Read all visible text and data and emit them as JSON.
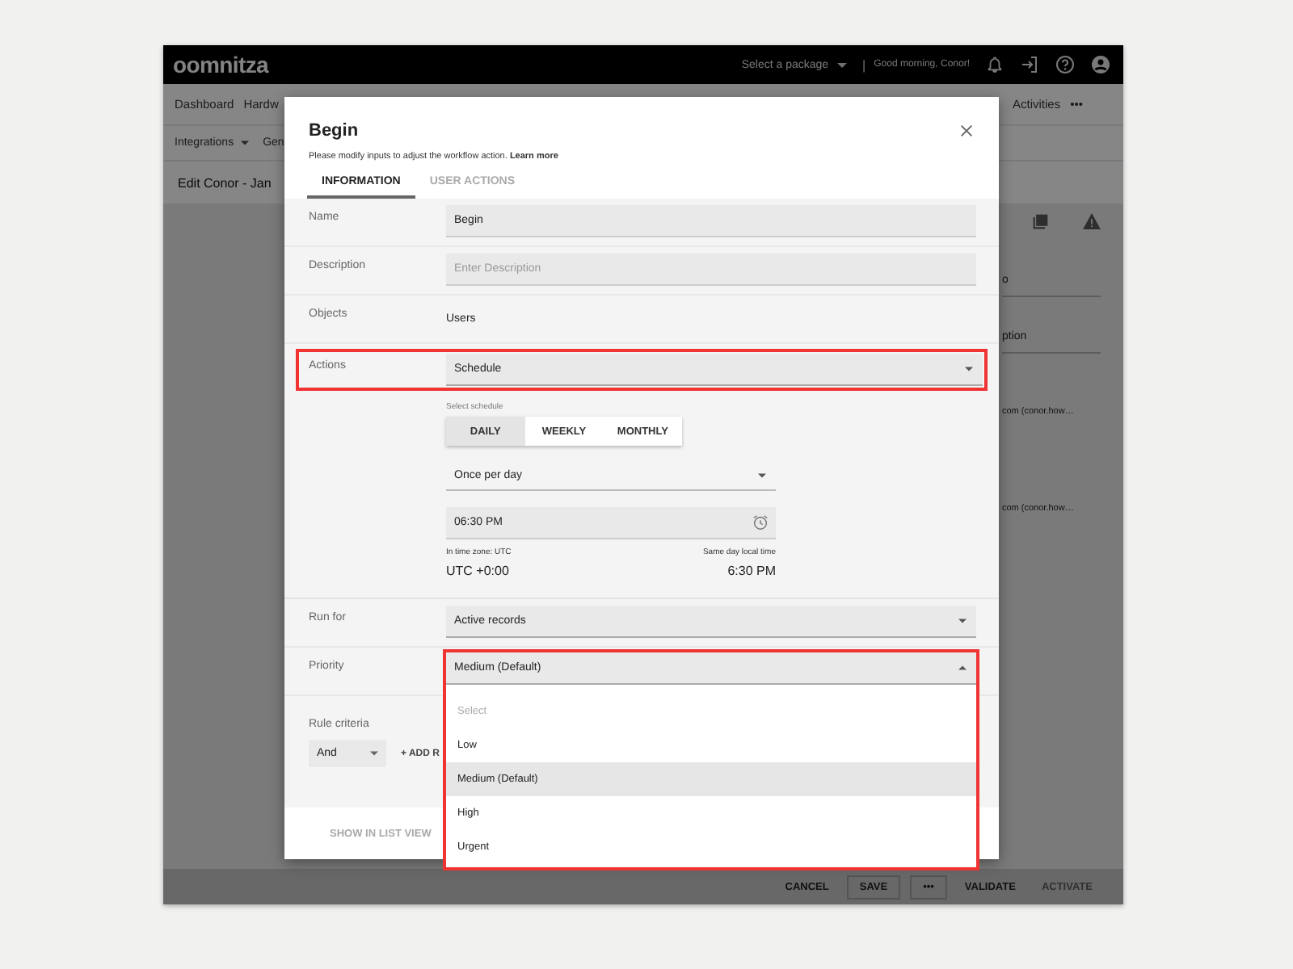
{
  "app_header": {
    "logo": "oomnitza",
    "package_select": "Select a package",
    "separator": "|",
    "greeting": "Good morning, Conor!"
  },
  "nav": {
    "left": [
      "Dashboard",
      "Hardw"
    ],
    "right": [
      "Activities",
      "•••"
    ]
  },
  "subnav": [
    {
      "label": "Integrations",
      "has_menu": true
    },
    {
      "label": "Gen",
      "has_menu": false
    }
  ],
  "page_title": "Edit Conor - Jan",
  "side_panel": {
    "fields": [
      "o",
      "ption"
    ],
    "values": [
      "com (conor.how…",
      "com (conor.how…"
    ]
  },
  "footer_bar": [
    {
      "label": "CANCEL",
      "kind": "text",
      "disabled": false
    },
    {
      "label": "SAVE",
      "kind": "outlined",
      "disabled": false
    },
    {
      "label": "•••",
      "kind": "outlined",
      "disabled": false
    },
    {
      "label": "VALIDATE",
      "kind": "text",
      "disabled": false
    },
    {
      "label": "ACTIVATE",
      "kind": "text",
      "disabled": true
    }
  ],
  "dialog": {
    "title": "Begin",
    "intro": "Please modify inputs to adjust the workflow action.",
    "learn_more": "Learn more",
    "tabs": [
      {
        "label": "INFORMATION",
        "selected": true
      },
      {
        "label": "USER ACTIONS",
        "selected": false
      }
    ],
    "rows": [
      {
        "kind": "input",
        "label": "Name",
        "value": "Begin"
      },
      {
        "kind": "input",
        "label": "Description",
        "placeholder": "Enter Description"
      },
      {
        "kind": "static",
        "label": "Objects",
        "value": "Users"
      },
      {
        "kind": "select",
        "label": "Actions",
        "value": "Schedule",
        "highlighted": true,
        "expanded": false
      },
      {
        "kind": "schedule",
        "caption": "Select schedule",
        "modes": [
          {
            "label": "DAILY",
            "selected": true
          },
          {
            "label": "WEEKLY",
            "selected": false
          },
          {
            "label": "MONTHLY",
            "selected": false
          }
        ],
        "frequency": "Once per day",
        "time": "06:30 PM",
        "zone_label": "In time zone: UTC",
        "zone_value": "UTC +0:00",
        "local_label": "Same day local time",
        "local_value": "6:30 PM"
      },
      {
        "kind": "select",
        "label": "Run for",
        "value": "Active records",
        "highlighted": false,
        "expanded": false
      },
      {
        "kind": "select",
        "label": "Priority",
        "value": "Medium (Default)",
        "highlighted": true,
        "expanded": true,
        "options": [
          {
            "label": "Select",
            "placeholder": true,
            "selected": false
          },
          {
            "label": "Low",
            "placeholder": false,
            "selected": false
          },
          {
            "label": "Medium (Default)",
            "placeholder": false,
            "selected": true
          },
          {
            "label": "High",
            "placeholder": false,
            "selected": false
          },
          {
            "label": "Urgent",
            "placeholder": false,
            "selected": false
          }
        ]
      },
      {
        "kind": "criteria",
        "label": "Rule criteria",
        "operator": "And",
        "add_label": "+ ADD R"
      }
    ],
    "footer_button": {
      "label": "SHOW IN LIST VIEW",
      "disabled": true
    }
  }
}
